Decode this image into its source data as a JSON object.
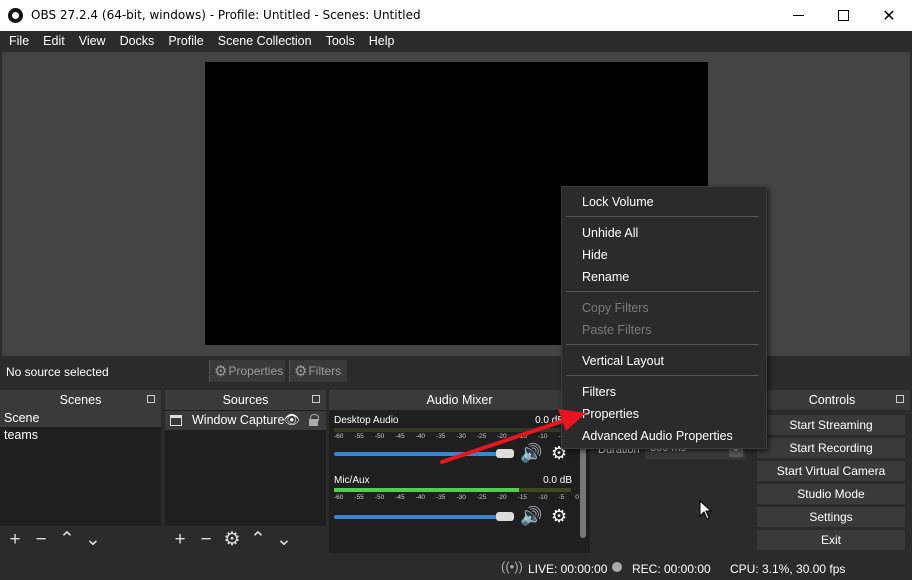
{
  "window": {
    "title": "OBS 27.2.4 (64-bit, windows) - Profile: Untitled - Scenes: Untitled"
  },
  "menubar": [
    "File",
    "Edit",
    "View",
    "Docks",
    "Profile",
    "Scene Collection",
    "Tools",
    "Help"
  ],
  "context_bar": {
    "status": "No source selected",
    "properties_label": "Properties",
    "filters_label": "Filters"
  },
  "scenes": {
    "title": "Scenes",
    "items": [
      "Scene",
      "teams"
    ]
  },
  "sources": {
    "title": "Sources",
    "items": [
      "Window Capture"
    ]
  },
  "mixer": {
    "title": "Audio Mixer",
    "tracks": [
      {
        "name": "Desktop Audio",
        "db": "0.0 dB",
        "level": 0.0
      },
      {
        "name": "Mic/Aux",
        "db": "0.0 dB",
        "level": 0.78
      }
    ],
    "scale": [
      "-60",
      "-55",
      "-50",
      "-45",
      "-40",
      "-35",
      "-30",
      "-25",
      "-20",
      "-15",
      "-10",
      "-5",
      "0"
    ]
  },
  "transitions": {
    "duration_label": "Duration",
    "duration_value": "300 ms"
  },
  "controls": {
    "title": "Controls",
    "buttons": [
      "Start Streaming",
      "Start Recording",
      "Start Virtual Camera",
      "Studio Mode",
      "Settings",
      "Exit"
    ]
  },
  "status_bar": {
    "live": "LIVE: 00:00:00",
    "rec": "REC: 00:00:00",
    "cpu": "CPU: 3.1%, 30.00 fps"
  },
  "context_menu": {
    "items": [
      {
        "label": "Lock Volume",
        "enabled": true
      },
      {
        "label": "Unhide All",
        "enabled": true
      },
      {
        "label": "Hide",
        "enabled": true
      },
      {
        "label": "Rename",
        "enabled": true
      },
      {
        "label": "Copy Filters",
        "enabled": false
      },
      {
        "label": "Paste Filters",
        "enabled": false
      },
      {
        "label": "Vertical Layout",
        "enabled": true
      },
      {
        "label": "Filters",
        "enabled": true
      },
      {
        "label": "Properties",
        "enabled": true
      },
      {
        "label": "Advanced Audio Properties",
        "enabled": true
      }
    ]
  },
  "annotation": {
    "arrow_color": "#e8141e"
  }
}
